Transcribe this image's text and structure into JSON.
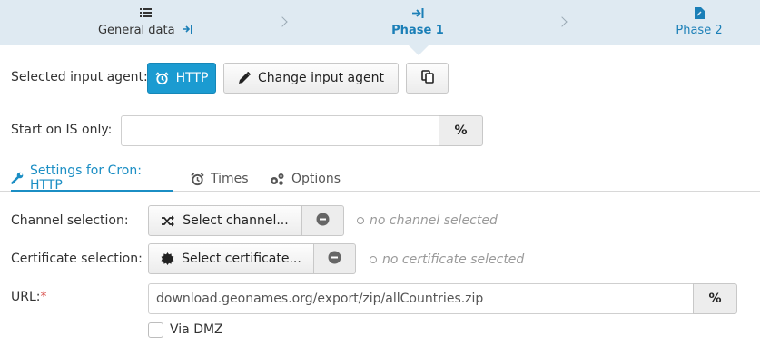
{
  "steps": [
    {
      "label": "General data",
      "icon": "list-icon",
      "suffix_icon": "arrow-to-right-icon"
    },
    {
      "label": "Phase 1",
      "icon": "arrow-to-right-icon"
    },
    {
      "label": "Phase 2",
      "icon": "file-icon"
    }
  ],
  "input_agent": {
    "label": "Selected input agent:",
    "agent_button": "HTTP",
    "change_button": "Change input agent"
  },
  "start_on_is": {
    "label": "Start on IS only:",
    "value": "",
    "percent_button": "%"
  },
  "tabs": [
    {
      "label": "Settings for Cron: HTTP",
      "icon": "wrench-icon",
      "active": true
    },
    {
      "label": "Times",
      "icon": "alarm-clock-icon",
      "active": false
    },
    {
      "label": "Options",
      "icon": "cogs-icon",
      "active": false
    }
  ],
  "channel": {
    "label": "Channel selection:",
    "button": "Select channel...",
    "hint": "no channel selected"
  },
  "certificate": {
    "label": "Certificate selection:",
    "button": "Select certificate...",
    "hint": "no certificate selected"
  },
  "url": {
    "label": "URL:",
    "required_mark": "*",
    "value": "download.geonames.org/export/zip/allCountries.zip",
    "percent_button": "%"
  },
  "via_dmz": {
    "label": "Via DMZ",
    "checked": false
  },
  "colors": {
    "accent": "#1b9bd1",
    "steps_bg": "#dfeaf2",
    "required": "#d9534f"
  }
}
